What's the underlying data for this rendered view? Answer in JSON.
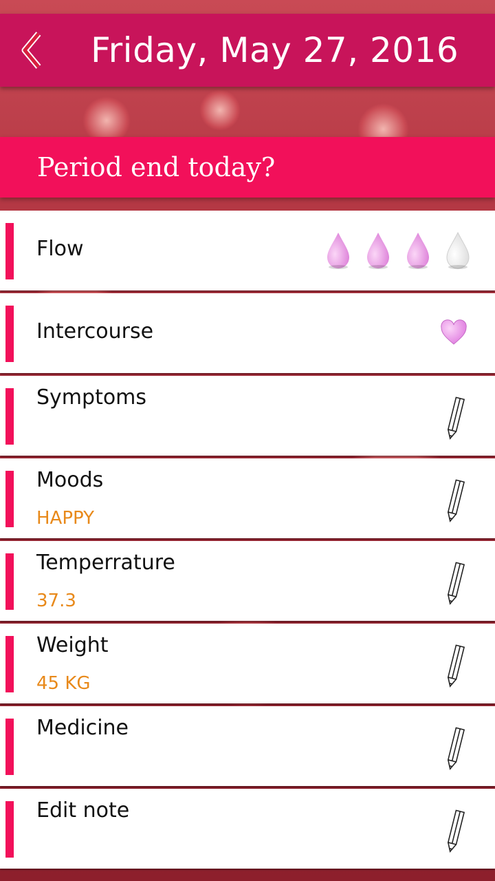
{
  "header": {
    "title": "Friday, May 27, 2016",
    "back_icon": "chevron-left-icon"
  },
  "banner": {
    "text": "Period end today?"
  },
  "rows": [
    {
      "label": "Flow",
      "icon": "drop-icon",
      "flow_level": 3,
      "flow_max": 4
    },
    {
      "label": "Intercourse",
      "icon": "heart-icon"
    },
    {
      "label": "Symptoms",
      "value": "",
      "icon": "pencil-icon"
    },
    {
      "label": "Moods",
      "value": "HAPPY",
      "icon": "pencil-icon"
    },
    {
      "label": "Temperrature",
      "value": "37.3",
      "icon": "pencil-icon"
    },
    {
      "label": "Weight",
      "value": "45 KG",
      "icon": "pencil-icon"
    },
    {
      "label": "Medicine",
      "value": "",
      "icon": "pencil-icon"
    },
    {
      "label": "Edit note",
      "value": "",
      "icon": "pencil-icon"
    }
  ],
  "colors": {
    "header": "#c8145a",
    "accent": "#f2105a",
    "value": "#e8891a",
    "drop_filled": "#e48ee0",
    "drop_empty": "#ffffff",
    "heart": "#ee88ee"
  }
}
